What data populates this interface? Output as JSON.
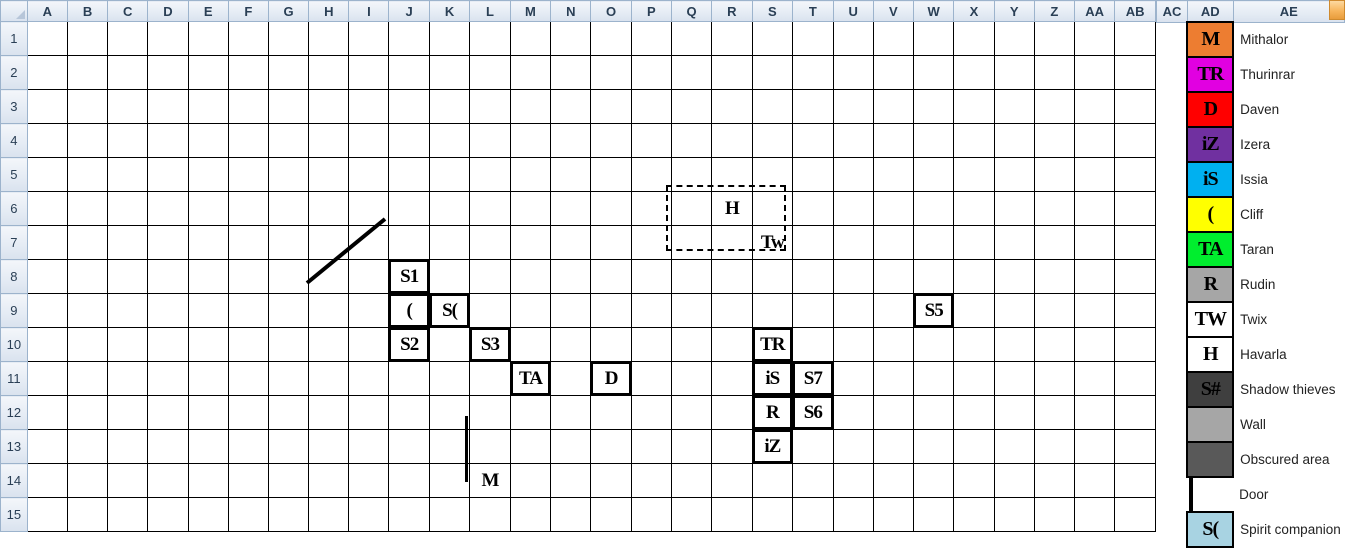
{
  "sheet": {
    "select_all": "select-all",
    "columns": [
      "A",
      "B",
      "C",
      "D",
      "E",
      "F",
      "G",
      "H",
      "I",
      "J",
      "K",
      "L",
      "M",
      "N",
      "O",
      "P",
      "Q",
      "R",
      "S",
      "T",
      "U",
      "V",
      "W",
      "X",
      "Y",
      "Z",
      "AA",
      "AB"
    ],
    "rows": [
      "1",
      "2",
      "3",
      "4",
      "5",
      "6",
      "7",
      "8",
      "9",
      "10",
      "11",
      "12",
      "13",
      "14",
      "15"
    ],
    "legend_columns": [
      "AC",
      "AD",
      "AE"
    ],
    "colors": {
      "wall": "#a6a6a6",
      "obscured": "#595959",
      "door": "#ffffff",
      "shadow_thief": "#3f3f3f",
      "spirit_companion": "#a8d3e2",
      "mithalor": "#ed7d31",
      "thurinrar": "#e100e1",
      "daven": "#ff0000",
      "izera": "#7030a0",
      "issia": "#00b0f0",
      "cliff": "#ffff00",
      "taran": "#00ee2e",
      "rudin": "#a6a6a6",
      "grid_line": "#000000",
      "header": "#d9e2ee"
    },
    "map": [
      [
        "wall",
        "wall",
        "wall",
        "wall",
        "wall",
        "wall",
        "wall",
        "wall",
        "wall",
        "wall",
        "wall",
        "wall",
        "wall",
        "wall",
        "wall",
        "wall",
        "wall",
        "wall",
        "wall",
        "wall",
        "wall",
        "wall",
        "wall",
        "wall",
        "wall",
        "wall",
        "wall",
        "wall"
      ],
      [
        "wall",
        "obsc",
        "obsc",
        "obsc",
        "obsc",
        "obsc",
        "obsc",
        "obsc",
        "obsc",
        "obsc",
        "obsc",
        "obsc",
        "obsc",
        "obsc",
        "obsc",
        "obsc",
        "obsc",
        "obsc",
        "obsc",
        "obsc",
        "obsc",
        "obsc",
        "obsc",
        "obsc",
        "obsc",
        "obsc",
        "obsc",
        "wall"
      ],
      [
        "wall",
        "obsc",
        "obsc",
        "obsc",
        "obsc",
        "obsc",
        "obsc",
        "obsc",
        "obsc",
        "obsc",
        "obsc",
        "obsc",
        "obsc",
        "obsc",
        "obsc",
        "obsc",
        "obsc",
        "obsc",
        "obsc",
        "obsc",
        "obsc",
        "obsc",
        "obsc",
        "obsc",
        "obsc",
        "obsc",
        "obsc",
        "wall"
      ],
      [
        "wall",
        "obsc",
        "obsc",
        "obsc",
        "obsc",
        "obsc",
        "obsc",
        "obsc",
        "obsc",
        "obsc",
        "obsc",
        "obsc",
        "obsc",
        "obsc",
        "obsc",
        "obsc",
        "obsc",
        "obsc",
        "obsc",
        "obsc",
        "obsc",
        "obsc",
        "obsc",
        "obsc",
        "obsc",
        "obsc",
        "obsc",
        "wall"
      ],
      [
        "wall",
        "obsc",
        "obsc",
        "obsc",
        "obsc",
        "obsc",
        "wall",
        "wall",
        "wall",
        "wall",
        "wall",
        "wall",
        "wall",
        "wall",
        "wall",
        "wall",
        "wall",
        "wall",
        "wall",
        "wall",
        "wall",
        "obsc",
        "obsc",
        "obsc",
        "obsc",
        "obsc",
        "obsc",
        "wall"
      ],
      [
        "wall",
        "obsc",
        "obsc",
        "obsc",
        "obsc",
        "obsc",
        "wall",
        "white",
        "white",
        "white",
        "white",
        "white",
        "white",
        "white",
        "white",
        "white",
        "white",
        "white",
        "white",
        "wall",
        "wall",
        "obsc",
        "obsc",
        "obsc",
        "obsc",
        "obsc",
        "obsc",
        "wall"
      ],
      [
        "wall",
        "obsc",
        "obsc",
        "white",
        "white",
        "white",
        "wall",
        "white",
        "white",
        "white",
        "white",
        "white",
        "white",
        "white",
        "white",
        "white",
        "white",
        "white",
        "white",
        "wall",
        "wall",
        "obsc",
        "obsc",
        "obsc",
        "obsc",
        "obsc",
        "obsc",
        "wall"
      ],
      [
        "wall",
        "obsc",
        "white",
        "white",
        "white",
        "white",
        "wall",
        "white",
        "white",
        "thief",
        "white",
        "white",
        "white",
        "white",
        "white",
        "white",
        "white",
        "white",
        "white",
        "wall",
        "obsc",
        "obsc",
        "obsc",
        "obsc",
        "obsc",
        "obsc",
        "obsc",
        "wall"
      ],
      [
        "wall",
        "obsc",
        "white",
        "white",
        "white",
        "white",
        "white",
        "white",
        "white",
        "yellow",
        "spirit",
        "white",
        "white",
        "white",
        "white",
        "white",
        "white",
        "white",
        "white",
        "wall",
        "obsc",
        "obsc",
        "thief",
        "white",
        "white",
        "obsc",
        "obsc",
        "wall"
      ],
      [
        "wall",
        "obsc",
        "white",
        "white",
        "white",
        "white",
        "wall",
        "white",
        "white",
        "thief",
        "white",
        "thief",
        "white",
        "white",
        "white",
        "white",
        "white",
        "white",
        "magenta",
        "wall",
        "white",
        "white",
        "white",
        "white",
        "white",
        "obsc",
        "obsc",
        "wall"
      ],
      [
        "wall",
        "obsc",
        "white",
        "white",
        "white",
        "white",
        "wall",
        "white",
        "white",
        "white",
        "white",
        "white",
        "green",
        "white",
        "red",
        "white",
        "white",
        "white",
        "cyan",
        "thief",
        "white",
        "white",
        "white",
        "white",
        "white",
        "white",
        "obsc",
        "wall"
      ],
      [
        "wall",
        "obsc",
        "obsc",
        "obsc",
        "white",
        "white",
        "wall",
        "white",
        "white",
        "white",
        "white",
        "white",
        "white",
        "white",
        "white",
        "white",
        "white",
        "white",
        "gray",
        "thief",
        "white",
        "white",
        "white",
        "white",
        "white",
        "white",
        "obsc",
        "wall"
      ],
      [
        "wall",
        "obsc",
        "obsc",
        "obsc",
        "obsc",
        "obsc",
        "wall",
        "white",
        "white",
        "white",
        "white",
        "white",
        "white",
        "white",
        "white",
        "white",
        "white",
        "white",
        "purple",
        "wall",
        "white",
        "white",
        "white",
        "white",
        "white",
        "white",
        "obsc",
        "wall"
      ],
      [
        "wall",
        "obsc",
        "obsc",
        "obsc",
        "obsc",
        "obsc",
        "wall",
        "white",
        "white",
        "white",
        "orange",
        "white",
        "white",
        "white",
        "white",
        "white",
        "white",
        "white",
        "white",
        "wall",
        "obsc",
        "white",
        "white",
        "white",
        "white",
        "obsc",
        "obsc",
        "wall"
      ],
      [
        "wall",
        "wall",
        "wall",
        "wall",
        "wall",
        "wall",
        "wall",
        "wall",
        "wall",
        "wall",
        "wall",
        "white",
        "white",
        "wall",
        "wall",
        "wall",
        "wall",
        "wall",
        "wall",
        "wall",
        "wall",
        "wall",
        "wall",
        "wall",
        "wall",
        "wall",
        "wall",
        "wall"
      ]
    ],
    "tokens": [
      {
        "cell": "J8",
        "label": "S1"
      },
      {
        "cell": "J9",
        "label": "("
      },
      {
        "cell": "K9",
        "label": "S("
      },
      {
        "cell": "J10",
        "label": "S2"
      },
      {
        "cell": "L10",
        "label": "S3"
      },
      {
        "cell": "W9",
        "label": "S5"
      },
      {
        "cell": "S10",
        "label": "TR"
      },
      {
        "cell": "M11",
        "label": "TA"
      },
      {
        "cell": "O11",
        "label": "D"
      },
      {
        "cell": "S11",
        "label": "iS"
      },
      {
        "cell": "T11",
        "label": "S7"
      },
      {
        "cell": "S12",
        "label": "R"
      },
      {
        "cell": "T12",
        "label": "S6"
      },
      {
        "cell": "S13",
        "label": "iZ"
      },
      {
        "cell": "L14",
        "label": "M"
      },
      {
        "cell": "R6",
        "label": "H"
      },
      {
        "cell": "S7",
        "label": "Tw"
      }
    ]
  },
  "legend": {
    "items": [
      {
        "glyph": "M",
        "label": "Mithalor",
        "fill": "#ed7d31",
        "icon": "mithalor-token"
      },
      {
        "glyph": "TR",
        "label": "Thurinrar",
        "fill": "#e100e1",
        "icon": "thurinrar-token"
      },
      {
        "glyph": "D",
        "label": "Daven",
        "fill": "#ff0000",
        "icon": "daven-token"
      },
      {
        "glyph": "iZ",
        "label": "Izera",
        "fill": "#7030a0",
        "icon": "izera-token"
      },
      {
        "glyph": "iS",
        "label": "Issia",
        "fill": "#00b0f0",
        "icon": "issia-token"
      },
      {
        "glyph": "(",
        "label": "Cliff",
        "fill": "#ffff00",
        "icon": "cliff-token"
      },
      {
        "glyph": "TA",
        "label": "Taran",
        "fill": "#00ee2e",
        "icon": "taran-token"
      },
      {
        "glyph": "R",
        "label": "Rudin",
        "fill": "#a6a6a6",
        "icon": "rudin-token"
      },
      {
        "glyph": "TW",
        "label": "Twix",
        "fill": "#ffffff",
        "icon": "twix-token"
      },
      {
        "glyph": "H",
        "label": "Havarla",
        "fill": "#ffffff",
        "icon": "havarla-token"
      },
      {
        "glyph": "S#",
        "label": "Shadow thieves",
        "fill": "#3f3f3f",
        "icon": "shadow-thieves-token"
      },
      {
        "glyph": "",
        "label": "Wall",
        "fill": "#a6a6a6",
        "icon": "wall-swatch"
      },
      {
        "glyph": "",
        "label": "Obscured area",
        "fill": "#595959",
        "icon": "obscured-swatch"
      },
      {
        "glyph": "",
        "label": "Door",
        "fill": "#ffffff",
        "icon": "door-swatch"
      },
      {
        "glyph": "S(",
        "label": "Spirit companion",
        "fill": "#a8d3e2",
        "icon": "spirit-companion-token"
      }
    ]
  }
}
